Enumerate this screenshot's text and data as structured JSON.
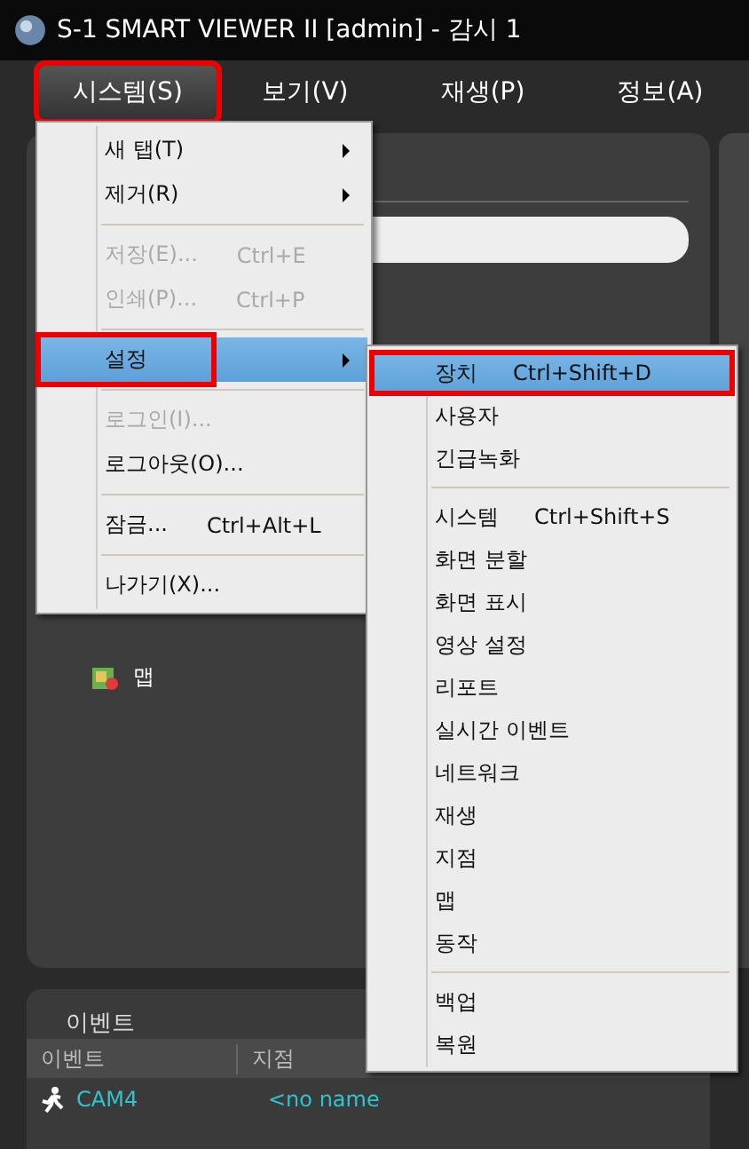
{
  "window": {
    "title": "S-1 SMART VIEWER II [admin] - 감시 1"
  },
  "menubar": [
    {
      "label": "시스템(S)",
      "selected": true,
      "highlighted": true
    },
    {
      "label": "보기(V)",
      "selected": false,
      "highlighted": false
    },
    {
      "label": "재생(P)",
      "selected": false,
      "highlighted": false
    },
    {
      "label": "정보(A)",
      "selected": false,
      "highlighted": false
    }
  ],
  "system_menu": [
    {
      "kind": "item",
      "label": "새 탭(T)",
      "submenu": true,
      "disabled": false,
      "selected": false,
      "highlighted": false
    },
    {
      "kind": "item",
      "label": "제거(R)",
      "submenu": true,
      "disabled": false,
      "selected": false,
      "highlighted": false
    },
    {
      "kind": "separator"
    },
    {
      "kind": "item",
      "label": "저장(E)...",
      "shortcut": "Ctrl+E",
      "disabled": true,
      "selected": false,
      "highlighted": false
    },
    {
      "kind": "item",
      "label": "인쇄(P)...",
      "shortcut": "Ctrl+P",
      "disabled": true,
      "selected": false,
      "highlighted": false
    },
    {
      "kind": "separator"
    },
    {
      "kind": "item",
      "label": "설정",
      "submenu": true,
      "disabled": false,
      "selected": true,
      "highlighted": true
    },
    {
      "kind": "separator"
    },
    {
      "kind": "item",
      "label": "로그인(I)...",
      "disabled": true,
      "selected": false,
      "highlighted": false
    },
    {
      "kind": "item",
      "label": "로그아웃(O)...",
      "disabled": false,
      "selected": false,
      "highlighted": false
    },
    {
      "kind": "separator"
    },
    {
      "kind": "item",
      "label": "잠금...",
      "shortcut": "Ctrl+Alt+L",
      "disabled": false,
      "selected": false,
      "highlighted": false
    },
    {
      "kind": "separator"
    },
    {
      "kind": "item",
      "label": "나가기(X)...",
      "disabled": false,
      "selected": false,
      "highlighted": false
    }
  ],
  "settings_submenu": [
    {
      "kind": "item",
      "label": "장치",
      "shortcut": "Ctrl+Shift+D",
      "selected": true,
      "highlighted": true
    },
    {
      "kind": "item",
      "label": "사용자",
      "selected": false,
      "highlighted": false
    },
    {
      "kind": "item",
      "label": "긴급녹화",
      "selected": false,
      "highlighted": false
    },
    {
      "kind": "separator"
    },
    {
      "kind": "item",
      "label": "시스템",
      "shortcut": "Ctrl+Shift+S",
      "selected": false,
      "highlighted": false
    },
    {
      "kind": "item",
      "label": "화면 분할",
      "selected": false,
      "highlighted": false
    },
    {
      "kind": "item",
      "label": "화면 표시",
      "selected": false,
      "highlighted": false
    },
    {
      "kind": "item",
      "label": "영상 설정",
      "selected": false,
      "highlighted": false
    },
    {
      "kind": "item",
      "label": "리포트",
      "selected": false,
      "highlighted": false
    },
    {
      "kind": "item",
      "label": "실시간 이벤트",
      "selected": false,
      "highlighted": false
    },
    {
      "kind": "item",
      "label": "네트워크",
      "selected": false,
      "highlighted": false
    },
    {
      "kind": "item",
      "label": "재생",
      "selected": false,
      "highlighted": false
    },
    {
      "kind": "item",
      "label": "지점",
      "selected": false,
      "highlighted": false
    },
    {
      "kind": "item",
      "label": "맵",
      "selected": false,
      "highlighted": false
    },
    {
      "kind": "item",
      "label": "동작",
      "selected": false,
      "highlighted": false
    },
    {
      "kind": "separator"
    },
    {
      "kind": "item",
      "label": "백업",
      "selected": false,
      "highlighted": false
    },
    {
      "kind": "item",
      "label": "복원",
      "selected": false,
      "highlighted": false
    }
  ],
  "tree": {
    "items": [
      {
        "label": "맵"
      }
    ]
  },
  "events": {
    "title": "이벤트",
    "columns": [
      "이벤트",
      "지점"
    ],
    "rows": [
      {
        "event": "CAM4",
        "site": "<no name"
      }
    ]
  }
}
